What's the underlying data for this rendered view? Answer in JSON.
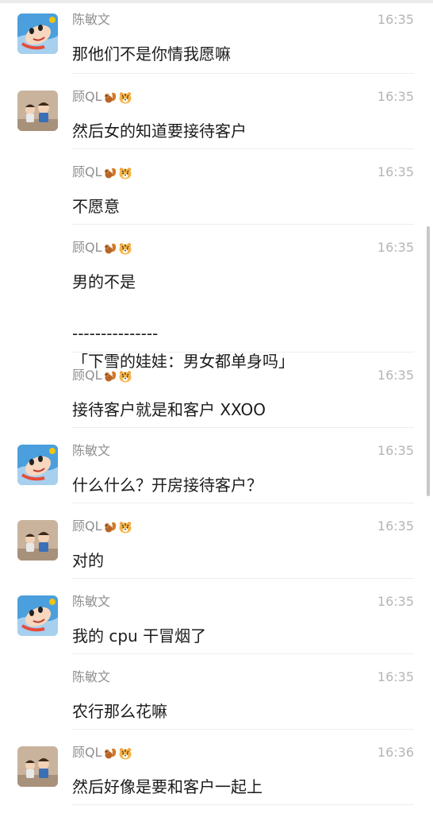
{
  "messages": [
    {
      "sender": "陈敏文",
      "time": "16:35",
      "avatar": "avatar-chen",
      "show_avatar": true,
      "lines": [
        "那他们不是你情我愿嘛"
      ]
    },
    {
      "sender": "顾QL",
      "time": "16:35",
      "avatar": "avatar-gu",
      "show_avatar": true,
      "sender_emoji": [
        "squirrel-emoji",
        "tiger-emoji"
      ],
      "lines": [
        "然后女的知道要接待客户"
      ]
    },
    {
      "sender": "顾QL",
      "time": "16:35",
      "avatar": "avatar-gu",
      "show_avatar": false,
      "sender_emoji": [
        "squirrel-emoji",
        "tiger-emoji"
      ],
      "lines": [
        "不愿意"
      ]
    },
    {
      "sender": "顾QL",
      "time": "16:35",
      "avatar": "avatar-gu",
      "show_avatar": false,
      "sender_emoji": [
        "squirrel-emoji",
        "tiger-emoji"
      ],
      "lines": [
        "男的不是",
        "---------------",
        "「下雪的娃娃：男女都单身吗」"
      ]
    },
    {
      "sender": "顾QL",
      "time": "16:35",
      "avatar": "avatar-gu",
      "show_avatar": false,
      "sender_emoji": [
        "squirrel-emoji",
        "tiger-emoji"
      ],
      "lines": [
        "接待客户就是和客户 XXOO"
      ]
    },
    {
      "sender": "陈敏文",
      "time": "16:35",
      "avatar": "avatar-chen",
      "show_avatar": true,
      "lines": [
        "什么什么？开房接待客户？"
      ]
    },
    {
      "sender": "顾QL",
      "time": "16:35",
      "avatar": "avatar-gu",
      "show_avatar": true,
      "sender_emoji": [
        "squirrel-emoji",
        "tiger-emoji"
      ],
      "lines": [
        "对的"
      ]
    },
    {
      "sender": "陈敏文",
      "time": "16:35",
      "avatar": "avatar-chen",
      "show_avatar": true,
      "lines": [
        "我的 cpu 干冒烟了"
      ]
    },
    {
      "sender": "陈敏文",
      "time": "16:35",
      "avatar": "avatar-chen",
      "show_avatar": false,
      "lines": [
        "农行那么花嘛"
      ]
    },
    {
      "sender": "顾QL",
      "time": "16:36",
      "avatar": "avatar-gu",
      "show_avatar": true,
      "sender_emoji": [
        "squirrel-emoji",
        "tiger-emoji"
      ],
      "lines": [
        "然后好像是要和客户一起上"
      ]
    }
  ]
}
